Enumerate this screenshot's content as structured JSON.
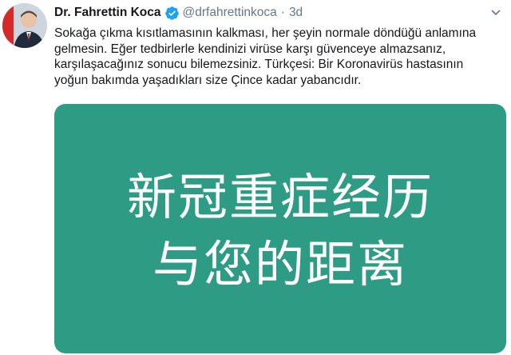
{
  "tweet": {
    "author": {
      "display_name": "Dr. Fahrettin Koca",
      "handle": "@drfahrettinkoca",
      "verified": true,
      "verified_icon": "verified-badge-icon",
      "avatar_icon": "avatar-photo"
    },
    "separator": "·",
    "time": "3d",
    "text_lines": [
      "Sokağa çıkma kısıtlamasının kalkması, her şeyin normale döndüğü anlamına",
      "gelmesin. Eğer tedbirlerle kendinizi virüse karşı güvenceye almazsanız,",
      "karşılaşacağınız sonucu bilemezsiniz. Türkçesi: Bir Koronavirüs hastasının",
      "yoğun bakımda yaşadıkları size Çince kadar yabancıdır."
    ],
    "media": {
      "line1": "新冠重症经历",
      "line2": "与您的距离"
    },
    "menu_icon": "chevron-down-icon"
  },
  "colors": {
    "text_primary": "#14171a",
    "text_secondary": "#657786",
    "verified_blue": "#1da1f2",
    "media_background": "#2e9b85",
    "media_text": "#ffffff"
  }
}
